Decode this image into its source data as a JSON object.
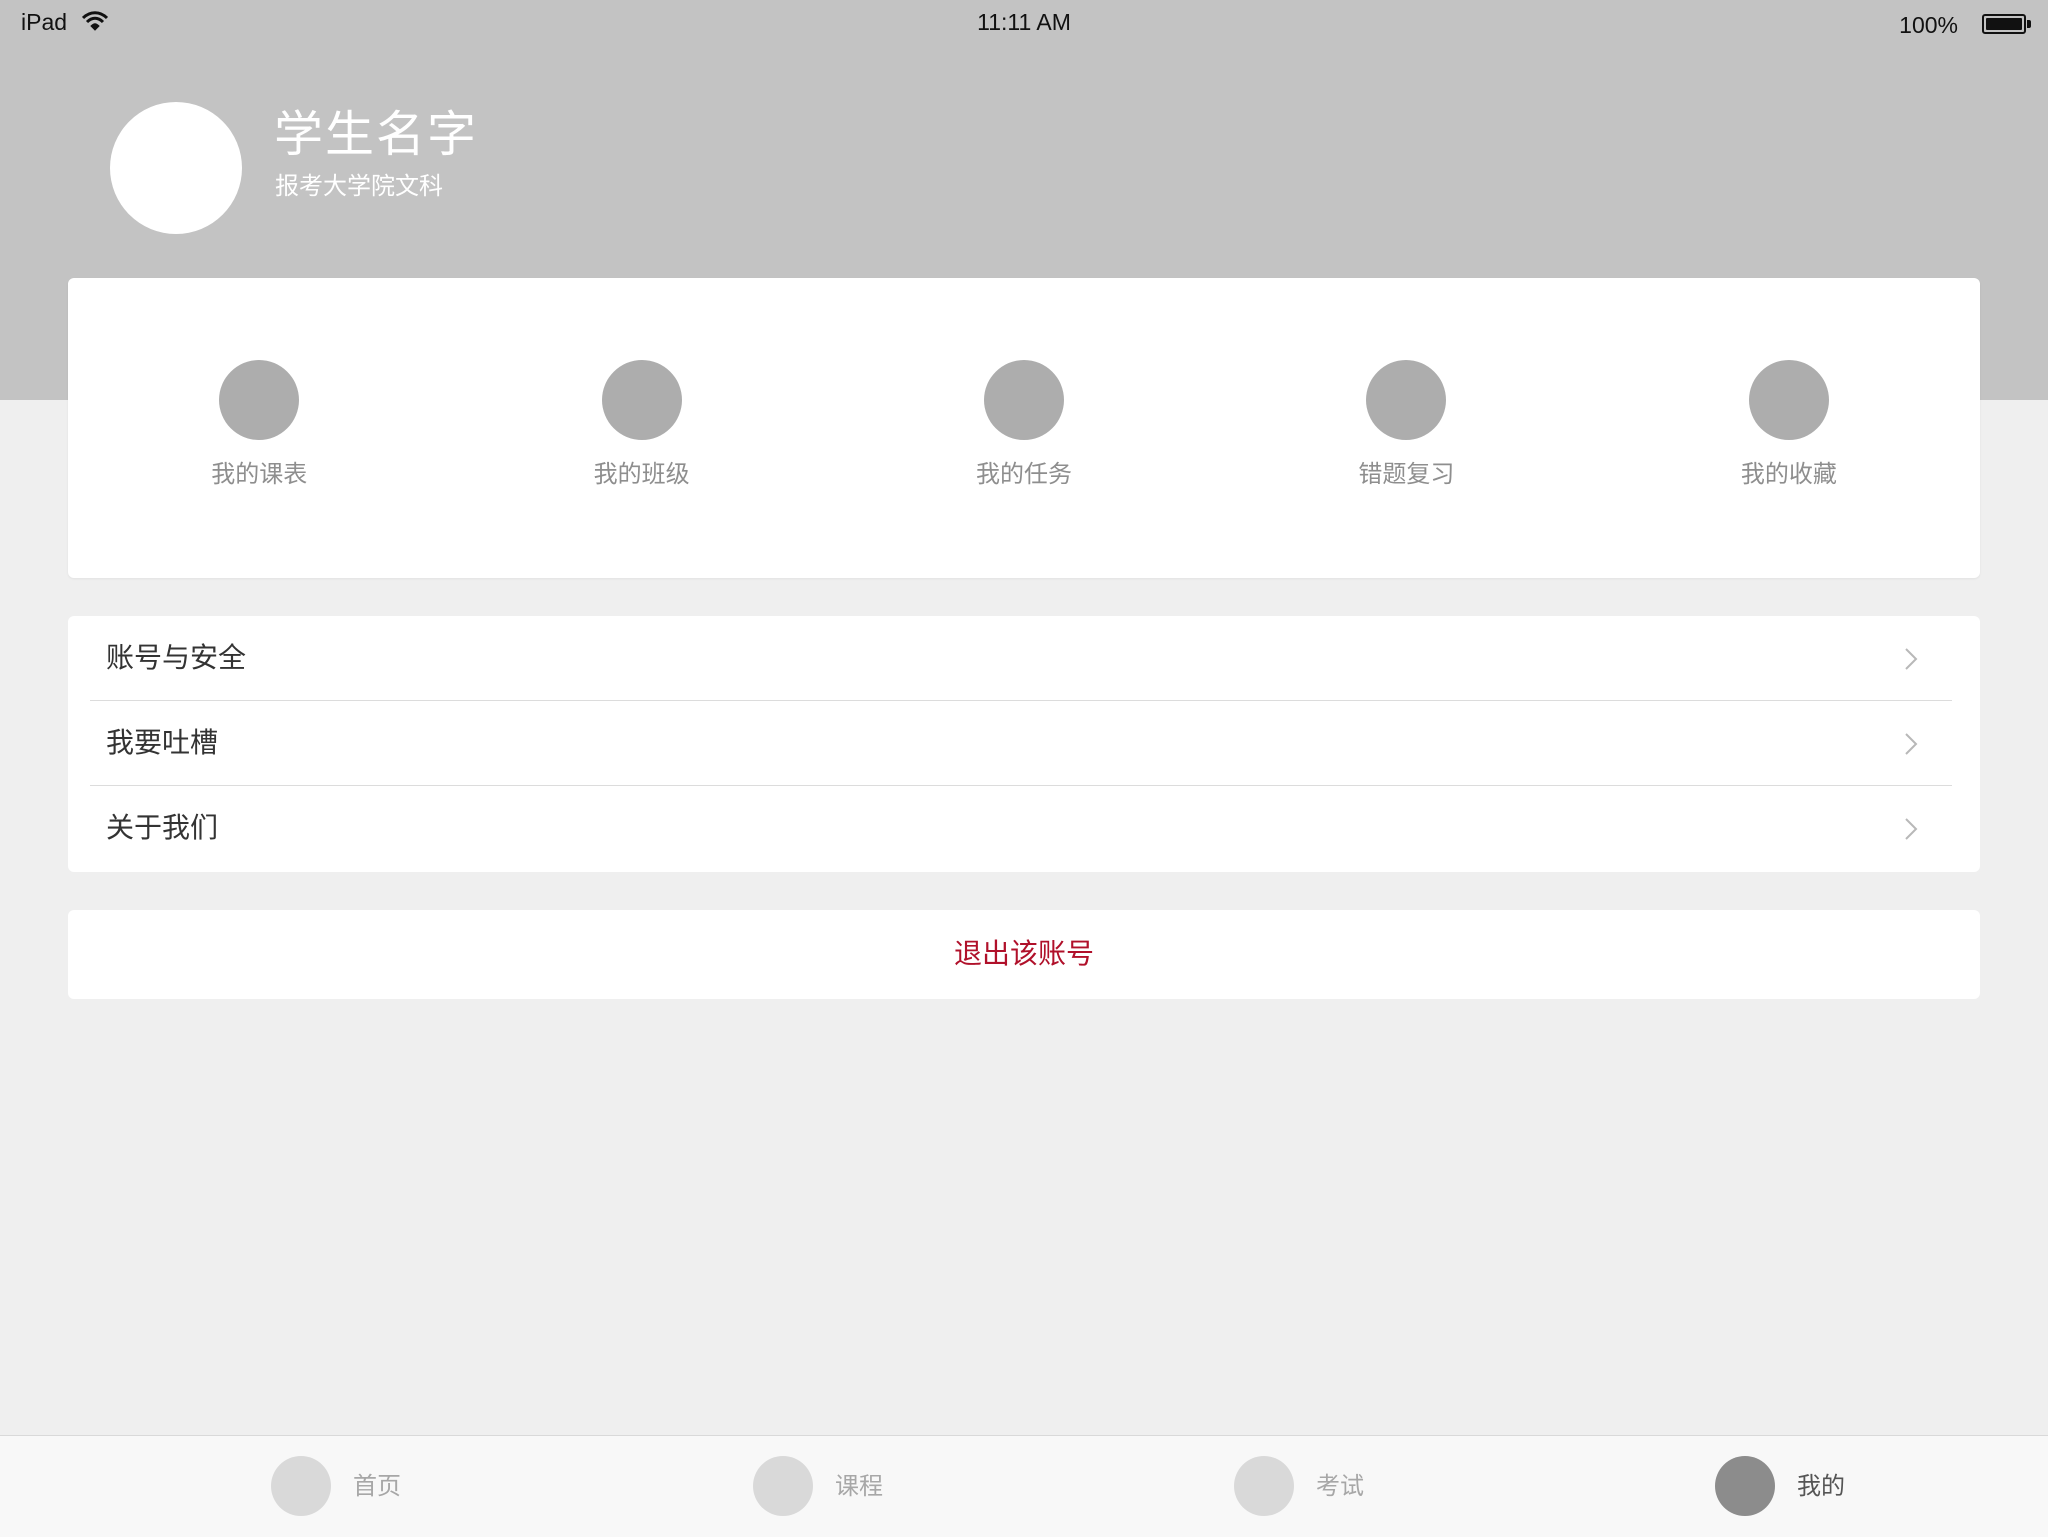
{
  "status_bar": {
    "device": "iPad",
    "time": "11:11 AM",
    "battery": "100%"
  },
  "profile": {
    "name": "学生名字",
    "subtitle": "报考大学院文科"
  },
  "shortcuts": [
    {
      "label": "我的课表",
      "icon": "schedule-icon"
    },
    {
      "label": "我的班级",
      "icon": "class-icon"
    },
    {
      "label": "我的任务",
      "icon": "task-icon"
    },
    {
      "label": "错题复习",
      "icon": "review-icon"
    },
    {
      "label": "我的收藏",
      "icon": "favorites-icon"
    }
  ],
  "settings": [
    {
      "label": "账号与安全"
    },
    {
      "label": "我要吐槽"
    },
    {
      "label": "关于我们"
    }
  ],
  "logout_label": "退出该账号",
  "tabs": [
    {
      "label": "首页",
      "icon": "home-icon",
      "active": false
    },
    {
      "label": "课程",
      "icon": "course-icon",
      "active": false
    },
    {
      "label": "考试",
      "icon": "exam-icon",
      "active": false
    },
    {
      "label": "我的",
      "icon": "profile-icon",
      "active": true
    }
  ],
  "colors": {
    "header_background": "#c3c3c3",
    "page_background": "#efefef",
    "logout_text": "#b0102a",
    "placeholder_icon": "#adadad",
    "active_tab_icon": "#8c8c8c"
  }
}
